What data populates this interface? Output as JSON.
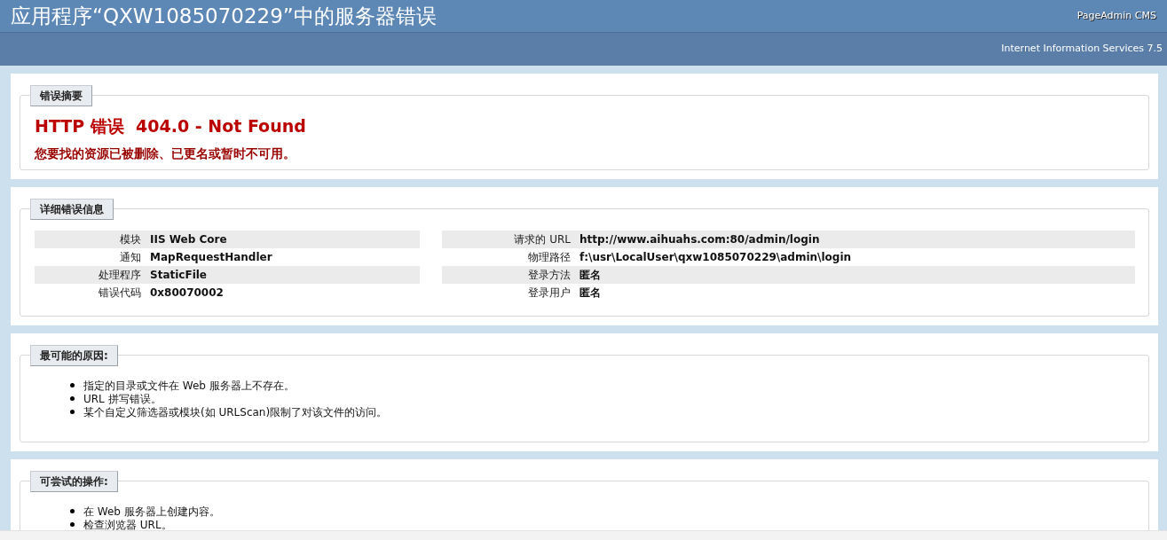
{
  "header": {
    "title": "应用程序“QXW1085070229”中的服务器错误",
    "brand": "PageAdmin CMS",
    "server": "Internet Information Services 7.5"
  },
  "summary": {
    "legend": "错误摘要",
    "heading": "HTTP 错误  404.0 - Not Found",
    "message": "您要找的资源已被删除、已更名或暂时不可用。"
  },
  "details": {
    "legend": "详细错误信息",
    "left": [
      {
        "label": "模块",
        "value": "IIS Web Core"
      },
      {
        "label": "通知",
        "value": "MapRequestHandler"
      },
      {
        "label": "处理程序",
        "value": "StaticFile"
      },
      {
        "label": "错误代码",
        "value": "0x80070002"
      }
    ],
    "right": [
      {
        "label": "请求的 URL",
        "value": "http://www.aihuahs.com:80/admin/login"
      },
      {
        "label": "物理路径",
        "value": "f:\\usr\\LocalUser\\qxw1085070229\\admin\\login"
      },
      {
        "label": "登录方法",
        "value": "匿名"
      },
      {
        "label": "登录用户",
        "value": "匿名"
      }
    ]
  },
  "causes": {
    "legend": "最可能的原因:",
    "items": [
      "指定的目录或文件在 Web 服务器上不存在。",
      "URL 拼写错误。",
      "某个自定义筛选器或模块(如 URLScan)限制了对该文件的访问。"
    ]
  },
  "actions": {
    "legend": "可尝试的操作:",
    "items": [
      "在 Web 服务器上创建内容。",
      "检查浏览器 URL。"
    ]
  }
}
